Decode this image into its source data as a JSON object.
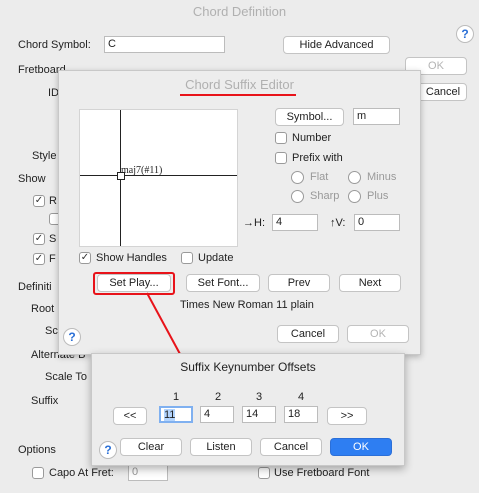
{
  "main": {
    "title": "Chord Definition",
    "chord_symbol_label": "Chord Symbol:",
    "chord_symbol_value": "C",
    "hide_advanced_button": "Hide Advanced",
    "fretboard_label": "Fretboard",
    "id_label": "ID",
    "ok_button": "OK",
    "cancel_button": "Cancel",
    "style_label": "Style",
    "show_label": "Show",
    "definition_label": "Definiti",
    "root_label": "Root",
    "scale_label": "Sc",
    "alternate_bass_label": "Alternate B",
    "scale_tone_label": "Scale To",
    "suffix_label": "Suffix",
    "options_label": "Options",
    "capo_label": "Capo At Fret:",
    "capo_value": "0",
    "use_fretboard_font_label": "Use Fretboard Font",
    "show_checks": [
      "R",
      "S",
      "F"
    ]
  },
  "suffix_editor": {
    "title": "Chord Suffix Editor",
    "preview_text": "maj7(#11)",
    "symbol_button": "Symbol...",
    "symbol_value": "m",
    "number_label": "Number",
    "prefix_with_label": "Prefix with",
    "flat_label": "Flat",
    "minus_label": "Minus",
    "sharp_label": "Sharp",
    "plus_label": "Plus",
    "h_label": "→H:",
    "h_value": "4",
    "v_label": "↑V:",
    "v_value": "0",
    "show_handles_label": "Show Handles",
    "update_label": "Update",
    "set_play_button": "Set Play...",
    "set_font_button": "Set Font...",
    "prev_button": "Prev",
    "next_button": "Next",
    "font_info": "Times New Roman 11 plain",
    "cancel_button": "Cancel",
    "ok_button": "OK"
  },
  "offsets_dialog": {
    "title": "Suffix Keynumber Offsets",
    "column_headers": [
      "1",
      "2",
      "3",
      "4"
    ],
    "values": [
      "11",
      "4",
      "14",
      "18"
    ],
    "prev_button": "<<",
    "next_button": ">>",
    "clear_button": "Clear",
    "listen_button": "Listen",
    "cancel_button": "Cancel",
    "ok_button": "OK"
  },
  "annotation_color": "#e8131a",
  "accent_color": "#2e7ef2"
}
